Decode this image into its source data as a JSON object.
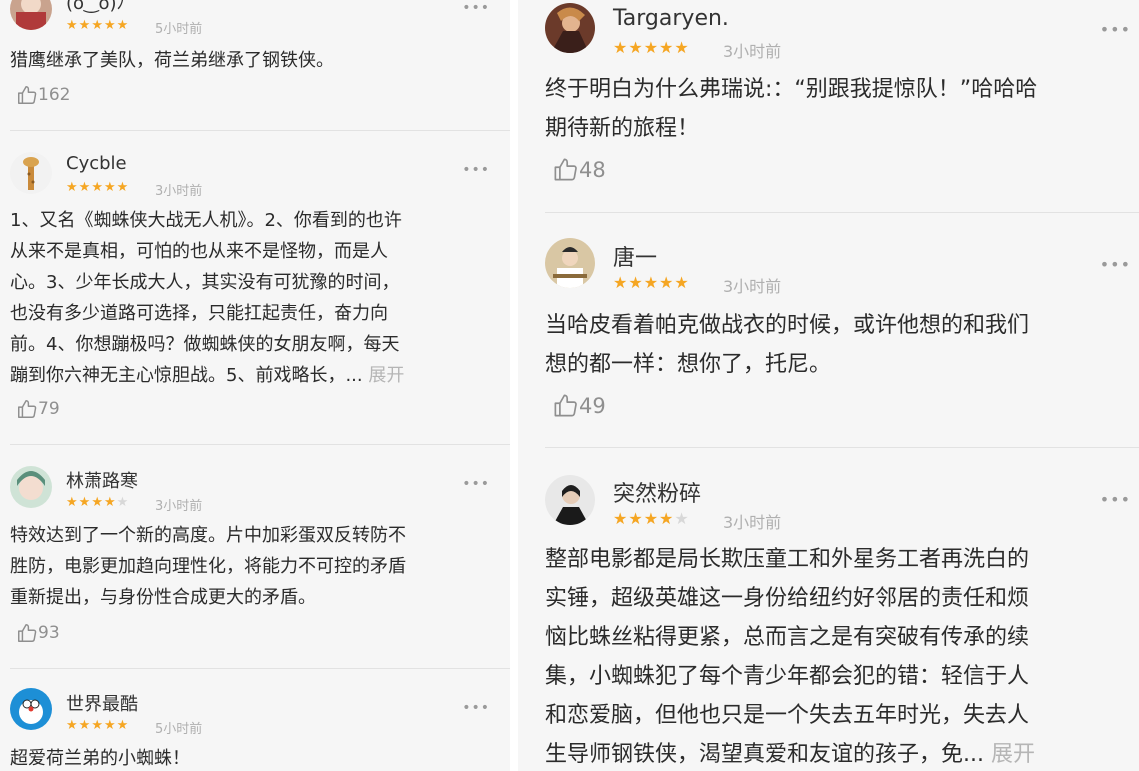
{
  "left": [
    {
      "user": "(ô‿ô)ﾉ",
      "rating": 5,
      "time": "5小时前",
      "text": "猎鹰继承了美队，荷兰弟继承了钢铁侠。",
      "likes": "162"
    },
    {
      "user": "Cycble",
      "rating": 5,
      "time": "3小时前",
      "text": "1、又名《蜘蛛侠大战无人机》。2、你看到的也许\n从来不是真相，可怕的也从来不是怪物，而是人\n心。3、少年长成大人，其实没有可犹豫的时间，\n也没有多少道路可选择，只能扛起责任，奋力向\n前。4、你想蹦极吗？做蜘蛛侠的女朋友啊，每天\n蹦到你六神无主心惊胆战。5、前戏略长，... ",
      "expand": "展开",
      "likes": "79"
    },
    {
      "user": "林萧路寒",
      "rating": 4,
      "time": "3小时前",
      "text": "特效达到了一个新的高度。片中加彩蛋双反转防不\n胜防，电影更加趋向理性化，将能力不可控的矛盾\n重新提出，与身份性合成更大的矛盾。",
      "likes": "93"
    },
    {
      "user": "世界最酷",
      "rating": 5,
      "time": "5小时前",
      "text": "超爱荷兰弟的小蜘蛛！"
    }
  ],
  "right": [
    {
      "user": "Targaryen.",
      "rating": 5,
      "time": "3小时前",
      "text": "终于明白为什么弗瑞说:：“别跟我提惊队！”哈哈哈\n期待新的旅程！",
      "likes": "48"
    },
    {
      "user": "唐一",
      "rating": 5,
      "time": "3小时前",
      "text": "当哈皮看着帕克做战衣的时候，或许他想的和我们\n想的都一样：想你了，托尼。",
      "likes": "49"
    },
    {
      "user": "突然粉碎",
      "rating": 4,
      "time": "3小时前",
      "text": "整部电影都是局长欺压童工和外星务工者再洗白的\n实锤，超级英雄这一身份给纽约好邻居的责任和烦\n恼比蛛丝粘得更紧，总而言之是有突破有传承的续\n集，小蜘蛛犯了每个青少年都会犯的错：轻信于人\n和恋爱脑，但他也只是一个失去五年时光，失去人\n生导师钢铁侠，渴望真爱和友谊的孩子，免... ",
      "expand": "展开"
    }
  ],
  "colors": {
    "star": "#f5a623",
    "star_off": "#d8d8d8",
    "muted": "#b0b0b0",
    "background": "#f6f6f6"
  },
  "icons": {
    "like": "thumbs-up-icon",
    "more": "more-dots-icon"
  }
}
